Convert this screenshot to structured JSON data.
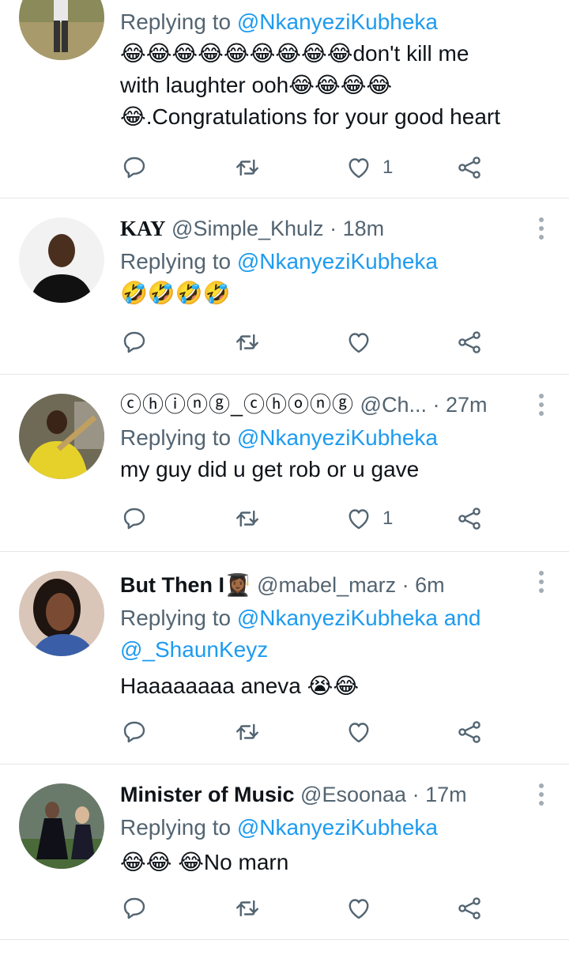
{
  "tweets": [
    {
      "name": "",
      "handle": "",
      "dot": "",
      "time": "",
      "replying_prefix": "Replying to ",
      "replying_to": "@NkanyeziKubheka",
      "text_lines": [
        "😂😂😂😂😂😂😂😂😂don't kill me",
        "with laughter ooh😂😂😂😂",
        "😂.Congratulations for your good heart"
      ],
      "likes": "1",
      "avatar": "avatar-person-standing"
    },
    {
      "name": "KAY",
      "handle": "@Simple_Khulz",
      "dot": "·",
      "time": "18m",
      "replying_prefix": "Replying to ",
      "replying_to": "@NkanyeziKubheka",
      "text_lines": [
        "🤣🤣🤣🤣"
      ],
      "likes": "",
      "avatar": "avatar-man-black-shirt"
    },
    {
      "name": "ⓒⓗⓘⓝⓖ_ⓒⓗⓞⓝⓖ",
      "handle": "@Ch...",
      "dot": "·",
      "time": "27m",
      "replying_prefix": "Replying to ",
      "replying_to": "@NkanyeziKubheka",
      "text_lines": [
        "my guy did u get rob or u gave"
      ],
      "likes": "1",
      "avatar": "avatar-yellow-outfit"
    },
    {
      "name": "But Then I👩🏾‍🎓",
      "handle": "@mabel_marz",
      "dot": "·",
      "time": "6m",
      "replying_prefix": "Replying to ",
      "replying_to": "@NkanyeziKubheka",
      "replying_and": " and",
      "replying_to_2": "@_ShaunKeyz",
      "text_lines": [
        "Haaaaaaaa aneva 😭😂"
      ],
      "likes": "",
      "avatar": "avatar-woman"
    },
    {
      "name": "Minister of Music",
      "handle": "@Esoonaa",
      "dot": "·",
      "time": "17m",
      "replying_prefix": "Replying to ",
      "replying_to": "@NkanyeziKubheka",
      "text_lines": [
        "😂😂 😂No marn"
      ],
      "likes": "",
      "avatar": "avatar-football-player"
    }
  ],
  "colors": {
    "link": "#1d9bf0",
    "secondary": "#536471",
    "icon": "#536471"
  }
}
